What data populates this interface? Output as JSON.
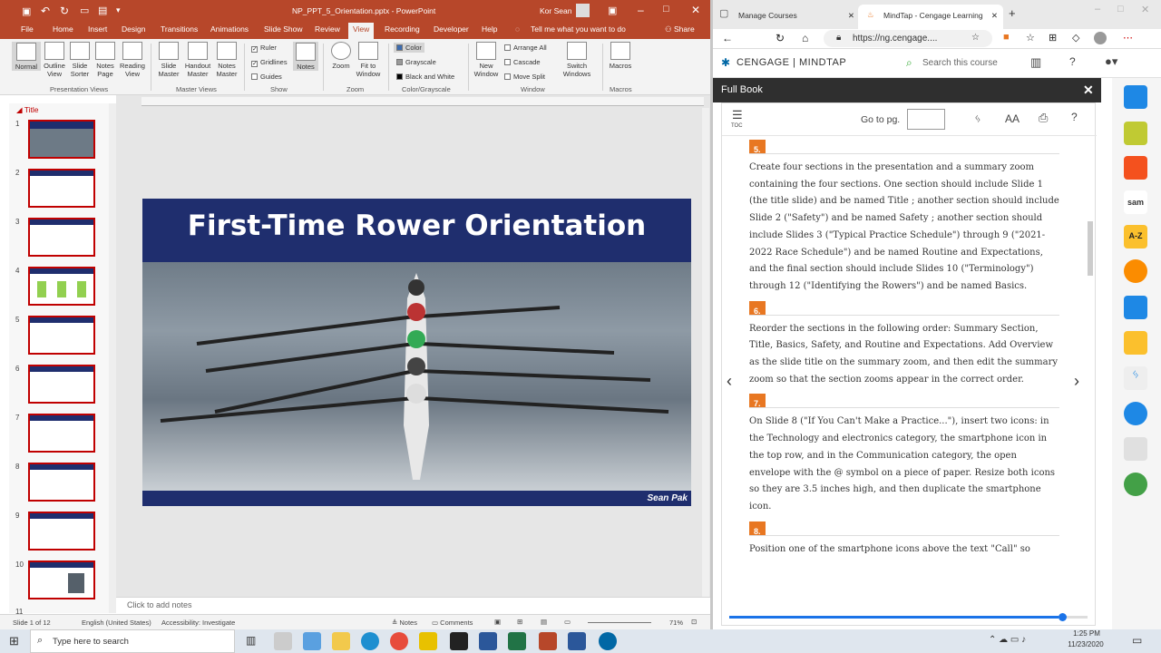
{
  "ppt": {
    "titlebar": {
      "doc": "NP_PPT_5_Orientation.pptx - PowerPoint",
      "user": "Kor Sean"
    },
    "tabs": [
      "File",
      "Home",
      "Insert",
      "Design",
      "Transitions",
      "Animations",
      "Slide Show",
      "Review",
      "Recording",
      "Developer",
      "Help"
    ],
    "active_tab": "View",
    "tell_me": "Tell me what you want to do",
    "share": "Share",
    "ribbon": {
      "normal": "Normal",
      "outline": "Outline View",
      "slide_sorter": "Slide Sorter",
      "notes_page": "Notes Page",
      "reading": "Reading View",
      "slide_master": "Slide Master",
      "handout_master": "Handout Master",
      "notes_master": "Notes Master",
      "ruler": "Ruler",
      "gridlines": "Gridlines",
      "guides": "Guides",
      "notes": "Notes",
      "zoom": "Zoom",
      "fit": "Fit to Window",
      "color": "Color",
      "grayscale": "Grayscale",
      "bw": "Black and White",
      "new_window": "New Window",
      "arrange_all": "Arrange All",
      "cascade": "Cascade",
      "move_split": "Move Split",
      "switch_windows": "Switch Windows",
      "macros": "Macros",
      "groups": [
        "Presentation Views",
        "Master Views",
        "Show",
        "Zoom",
        "Color/Grayscale",
        "Window",
        "Macros"
      ]
    },
    "section_title": "Title",
    "slide": {
      "title": "First-Time Rower Orientation",
      "author": "Sean Pak"
    },
    "thumbs": [
      "1",
      "2",
      "3",
      "4",
      "5",
      "6",
      "7",
      "8",
      "9",
      "10",
      "11"
    ],
    "notes_placeholder": "Click to add notes",
    "status": {
      "slide": "Slide 1 of 12",
      "lang": "English (United States)",
      "access": "Accessibility: Investigate",
      "notes": "Notes",
      "comments": "Comments",
      "zoom": "71%"
    }
  },
  "browser": {
    "tabs": [
      {
        "label": "Manage Courses"
      },
      {
        "label": "MindTap - Cengage Learning"
      }
    ],
    "url": "https://ng.cengage....",
    "brand": "CENGAGE | MINDTAP",
    "search": "Search this course",
    "panel_title": "Full Book",
    "toc": "TOC",
    "goto": "Go to pg.",
    "font_size": "AA",
    "steps": [
      {
        "num": "5.",
        "text": "Create four sections in the presentation and a summary zoom containing the four sections. One section should include Slide 1 (the title slide) and be named Title ; another section should include Slide 2 (\"Safety\") and be named Safety ; another section should include Slides 3 (\"Typical Practice Schedule\") through 9 (\"2021-2022 Race Schedule\") and be named Routine and Expectations, and the final section should include Slides 10 (\"Terminology\") through 12 (\"Identifying the Rowers\") and be named Basics."
      },
      {
        "num": "6.",
        "text": "Reorder the sections in the following order: Summary Section, Title, Basics, Safety, and Routine and Expectations. Add Overview as the slide title on the summary zoom, and then edit the summary zoom so that the section zooms appear in the correct order."
      },
      {
        "num": "7.",
        "text": "On Slide 8 (\"If You Can't Make a Practice...\"), insert two icons: in the Technology and electronics category, the smartphone icon in the top row, and in the Communication category, the open envelope with the @ symbol on a piece of paper. Resize both icons so they are 3.5 inches high, and then duplicate the smartphone icon."
      },
      {
        "num": "8.",
        "text": "Position one of the smartphone icons above the text \"Call\" so"
      }
    ]
  },
  "taskbar": {
    "search": "Type here to search",
    "time": "1:25 PM",
    "date": "11/23/2020"
  },
  "colors": {
    "ppt": "#b7472a",
    "slide": "#1f2e6e",
    "accent": "#e87722",
    "progress": "#1a73e8"
  }
}
